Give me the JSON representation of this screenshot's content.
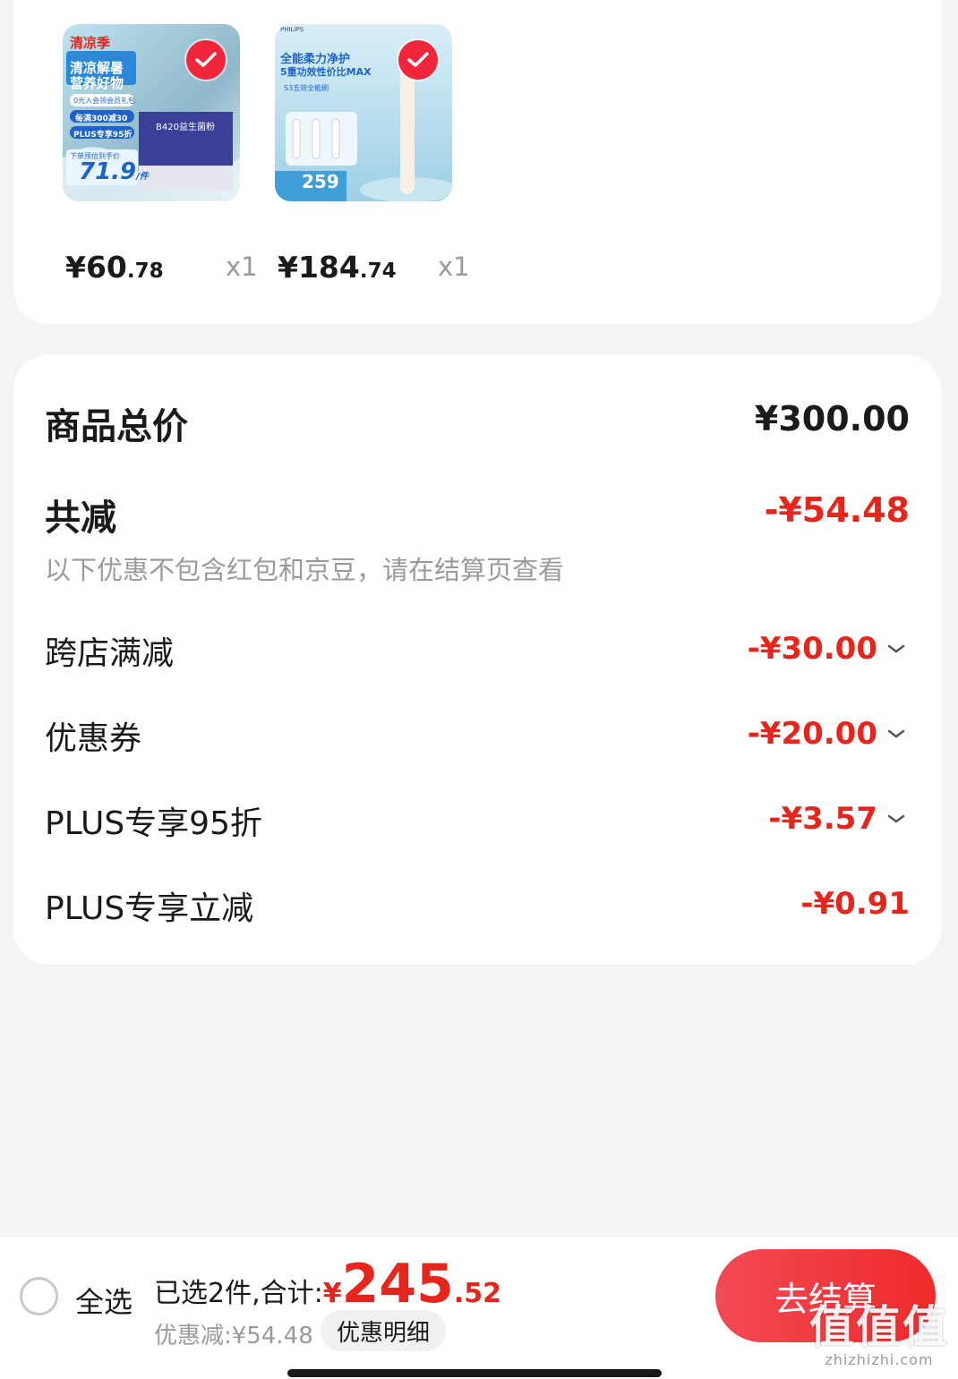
{
  "products": [
    {
      "image_text": {
        "brand": "清凉季",
        "headline_1": "清凉解暑",
        "headline_2": "营养好物",
        "chip_1": "0元入会领会员礼包",
        "chip_2": "每满300减30",
        "chip_3": "PLUS专享95折",
        "note": "下单预估到手价",
        "promo_price": "71.9",
        "unit": "/件",
        "box_text": "B420益生菌粉"
      },
      "price_currency": "¥",
      "price_int": "60",
      "price_dec": ".78",
      "qty": "x1"
    },
    {
      "image_text": {
        "brand": "PHILIPS",
        "headline_1": "全能柔力净护",
        "headline_2": "5重功效性价比MAX",
        "sub": "S3五效全能刷",
        "promo_price": "259"
      },
      "price_currency": "¥",
      "price_int": "184",
      "price_dec": ".74",
      "qty": "x1"
    }
  ],
  "summary": {
    "total_label": "商品总价",
    "total_value": "¥300.00",
    "reduce_label": "共减",
    "reduce_value": "-¥54.48",
    "note": "以下优惠不包含红包和京豆，请在结算页查看",
    "items": [
      {
        "label": "跨店满减",
        "value": "-¥30.00",
        "expandable": true
      },
      {
        "label": "优惠券",
        "value": "-¥20.00",
        "expandable": true
      },
      {
        "label": "PLUS专享95折",
        "value": "-¥3.57",
        "expandable": true
      },
      {
        "label": "PLUS专享立减",
        "value": "-¥0.91",
        "expandable": false
      }
    ]
  },
  "bottom": {
    "select_all": "全选",
    "selected_label": "已选2件,合计:",
    "total_currency": "¥",
    "total_int": "245",
    "total_dec": ".52",
    "discount_text": "优惠减:¥54.48",
    "detail_button": "优惠明细",
    "checkout_button": "去结算"
  },
  "watermark": {
    "big": "值值值",
    "small": "zhizhizhi.com"
  },
  "colors": {
    "accent_red": "#e5261d",
    "checkout_red": "#ef2a2a",
    "muted_gray": "#9a9a9a"
  }
}
